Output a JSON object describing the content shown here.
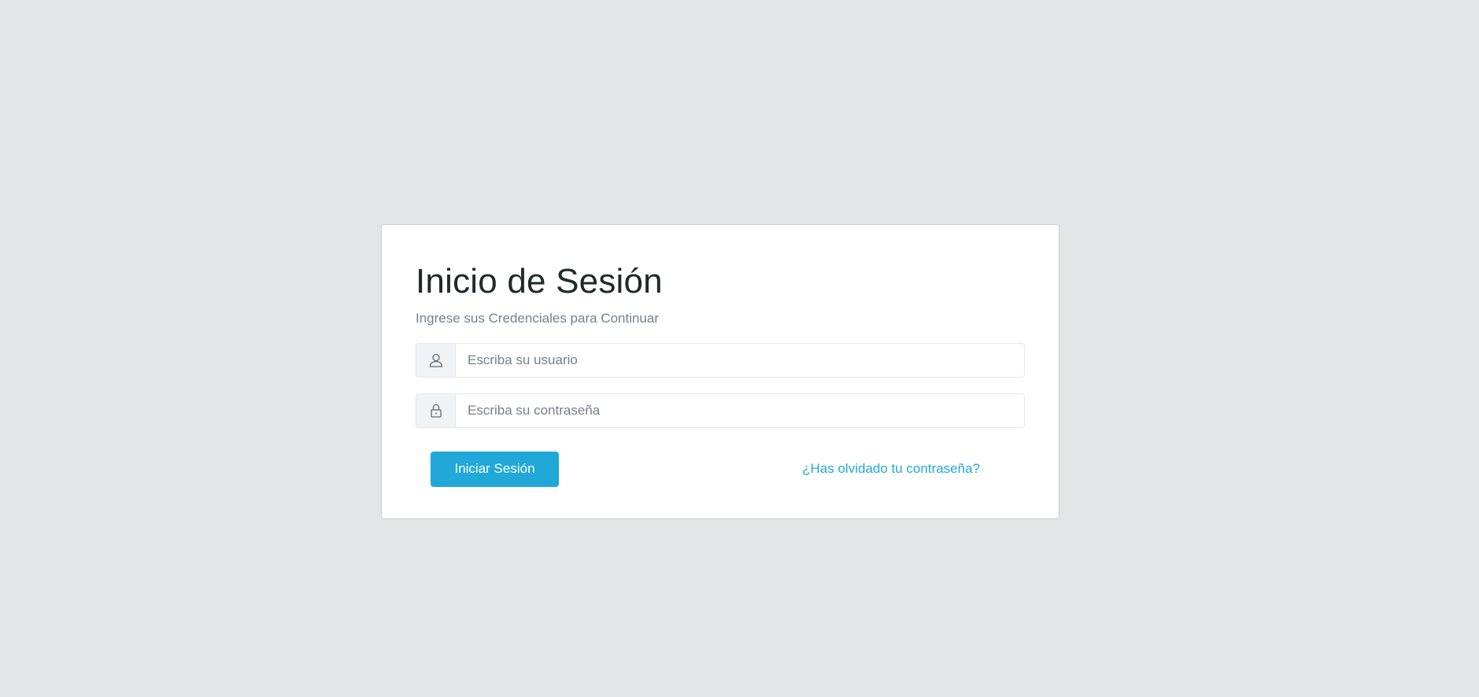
{
  "login": {
    "title": "Inicio de Sesión",
    "subtitle": "Ingrese sus Credenciales para Continuar",
    "username": {
      "placeholder": "Escriba su usuario",
      "value": "",
      "icon": "user-icon"
    },
    "password": {
      "placeholder": "Escriba su contraseña",
      "value": "",
      "icon": "lock-icon"
    },
    "submit_label": "Iniciar Sesión",
    "forgot_label": "¿Has olvidado tu contraseña?"
  },
  "colors": {
    "background": "#e4e5e7",
    "card": "#ffffff",
    "primary": "#20a8d8",
    "title_text": "#23282c",
    "muted_text": "#73818f",
    "addon_bg": "#f0f3f5"
  }
}
